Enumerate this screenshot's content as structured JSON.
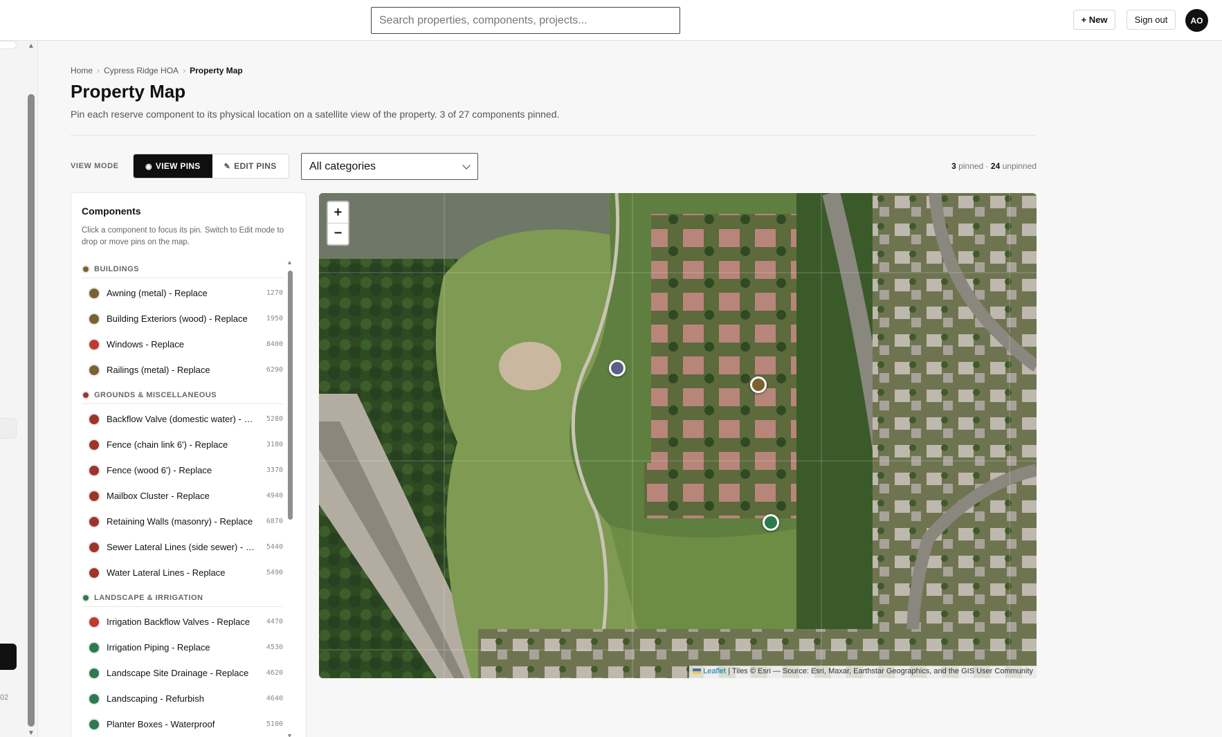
{
  "search": {
    "placeholder": "Search properties, components, projects..."
  },
  "topbar": {
    "new_label": "+ New",
    "signout_label": "Sign out",
    "avatar_initials": "AO"
  },
  "leftrail": {
    "footer_text": "02"
  },
  "breadcrumb": {
    "home": "Home",
    "property": "Cypress Ridge HOA",
    "current": "Property Map",
    "separator": "›"
  },
  "page": {
    "title": "Property Map",
    "description": "Pin each reserve component to its physical location on a satellite view of the property. 3 of 27 components pinned."
  },
  "toolbar": {
    "view_mode_label": "VIEW MODE",
    "view_pins_label": "VIEW PINS",
    "view_pins_icon": "eye-icon",
    "edit_pins_label": "EDIT PINS",
    "edit_pins_icon": "pencil-icon",
    "category_selected": "All categories",
    "pinned_count": "3",
    "pinned_text": "pinned ·",
    "unpinned_count": "24",
    "unpinned_text": "unpinned"
  },
  "components": {
    "title": "Components",
    "help": "Click a component to focus its pin. Switch to Edit mode to drop or move pins on the map.",
    "groups": [
      {
        "name": "BUILDINGS",
        "color": "#7a6230",
        "items": [
          {
            "name": "Awning (metal) - Replace",
            "code": "1270",
            "color": "#7a6230"
          },
          {
            "name": "Building Exteriors (wood) - Replace",
            "code": "1950",
            "color": "#7a6230"
          },
          {
            "name": "Windows - Replace",
            "code": "8400",
            "color": "#c0392b"
          },
          {
            "name": "Railings (metal) - Replace",
            "code": "6290",
            "color": "#7a6230"
          }
        ]
      },
      {
        "name": "GROUNDS & MISCELLANEOUS",
        "color": "#a0342a",
        "items": [
          {
            "name": "Backflow Valve (domestic water) - Replace",
            "code": "5280",
            "color": "#a0342a"
          },
          {
            "name": "Fence (chain link 6') - Replace",
            "code": "3180",
            "color": "#a0342a"
          },
          {
            "name": "Fence (wood 6') - Replace",
            "code": "3370",
            "color": "#a0342a"
          },
          {
            "name": "Mailbox Cluster - Replace",
            "code": "4940",
            "color": "#a0342a"
          },
          {
            "name": "Retaining Walls (masonry) - Replace",
            "code": "6870",
            "color": "#a0342a"
          },
          {
            "name": "Sewer Lateral Lines (side sewer) - Replace",
            "code": "5440",
            "color": "#a0342a"
          },
          {
            "name": "Water Lateral Lines - Replace",
            "code": "5490",
            "color": "#a0342a"
          }
        ]
      },
      {
        "name": "LANDSCAPE & IRRIGATION",
        "color": "#2e7a4f",
        "items": [
          {
            "name": "Irrigation Backflow Valves - Replace",
            "code": "4470",
            "color": "#c0392b"
          },
          {
            "name": "Irrigation Piping - Replace",
            "code": "4530",
            "color": "#2e7a4f"
          },
          {
            "name": "Landscape Site Drainage - Replace",
            "code": "4620",
            "color": "#2e7a4f"
          },
          {
            "name": "Landscaping - Refurbish",
            "code": "4640",
            "color": "#2e7a4f"
          },
          {
            "name": "Planter Boxes - Waterproof",
            "code": "5100",
            "color": "#2e7a4f"
          }
        ]
      }
    ]
  },
  "map": {
    "zoom_in": "+",
    "zoom_out": "−",
    "attribution_leaflet": "Leaflet",
    "attribution_rest": " | Tiles © Esri — Source: Esri, Maxar, Earthstar Geographics, and the GIS User Community",
    "pins": [
      {
        "color": "#5a6086"
      },
      {
        "color": "#7a6230"
      },
      {
        "color": "#2e7a4f"
      }
    ]
  }
}
